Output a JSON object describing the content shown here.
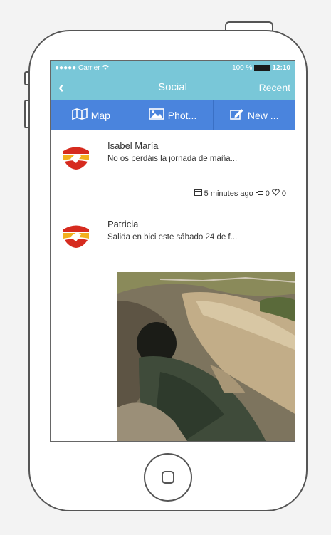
{
  "status_bar": {
    "carrier": "●●●●● Carrier",
    "battery": "100 %",
    "time": "12:10"
  },
  "nav_bar": {
    "back": "‹",
    "title": "Social",
    "right_action": "Recent"
  },
  "toolbar": {
    "map_label": "Map",
    "photo_label": "Phot...",
    "new_label": "New ..."
  },
  "posts": [
    {
      "author": "Isabel María",
      "text": "No os perdáis la jornada de maña...",
      "time": "5 minutes ago",
      "comments": "0",
      "likes": "0"
    },
    {
      "author": "Patricia",
      "text": "Salida en bici este sábado 24 de f..."
    }
  ],
  "colors": {
    "nav_bg": "#79c7d8",
    "toolbar_bg": "#4a84dd"
  }
}
